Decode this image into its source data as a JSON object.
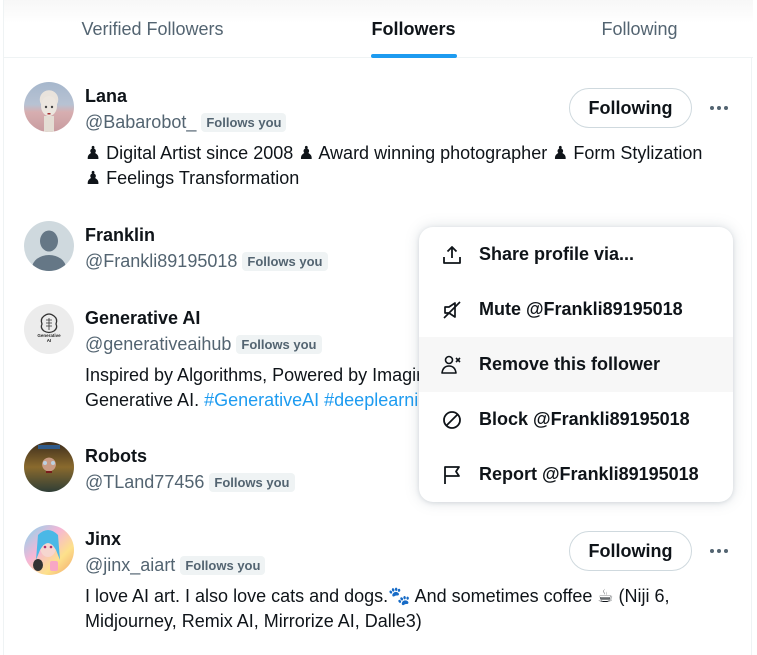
{
  "tabs": [
    {
      "label": "Verified Followers",
      "active": false
    },
    {
      "label": "Followers",
      "active": true
    },
    {
      "label": "Following",
      "active": false
    }
  ],
  "colors": {
    "accent": "#1d9bf0",
    "text_primary": "#0f1419",
    "text_secondary": "#536471",
    "border": "#eff3f4",
    "menu_hover": "#f7f7f7"
  },
  "users": [
    {
      "name": "Lana",
      "handle": "@Babarobot_",
      "badge": "Follows you",
      "bio_lines": [
        "♟ Digital Artist since 2008 ♟ Award winning photographer ♟ Form Stylization",
        "♟ Feelings Transformation"
      ],
      "button": "Following",
      "more_icon": "more-horizontal-icon"
    },
    {
      "name": "Franklin",
      "handle": "@Frankli89195018",
      "badge": "Follows you",
      "avatar": "default-avatar-icon"
    },
    {
      "name": "Generative AI",
      "handle": "@generativeaihub",
      "badge": "Follows you",
      "avatar_text": "Generative AI",
      "bio_line1": "Inspired by Algorithms, Powered by Imagination",
      "bio_line2_prefix": "Generative AI. ",
      "bio_hashtags": "#GenerativeAI #deeplearning"
    },
    {
      "name": "Robots",
      "handle": "@TLand77456",
      "badge": "Follows you"
    },
    {
      "name": "Jinx",
      "handle": "@jinx_aiart",
      "badge": "Follows you",
      "bio_lines": [
        "I love AI art. I also love cats and dogs.🐾 And sometimes coffee ☕ (Niji 6,",
        "Midjourney, Remix AI, Mirrorize AI, Dalle3)"
      ],
      "button": "Following",
      "more_icon": "more-horizontal-icon"
    }
  ],
  "menu": {
    "items": [
      {
        "label": "Share profile via...",
        "icon": "share-icon"
      },
      {
        "label": "Mute @Frankli89195018",
        "icon": "mute-icon"
      },
      {
        "label": "Remove this follower",
        "icon": "remove-follower-icon",
        "hovered": true
      },
      {
        "label": "Block @Frankli89195018",
        "icon": "block-icon"
      },
      {
        "label": "Report @Frankli89195018",
        "icon": "report-flag-icon"
      }
    ]
  }
}
